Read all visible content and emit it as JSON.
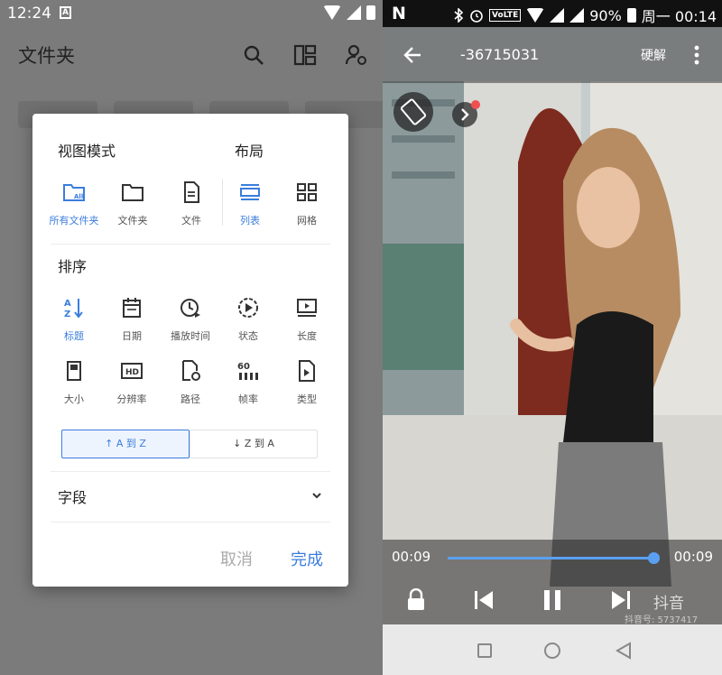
{
  "left": {
    "status": {
      "time": "12:24"
    },
    "appbar": {
      "title": "文件夹"
    },
    "dialog": {
      "view_mode_label": "视图模式",
      "layout_label": "布局",
      "view_modes": [
        {
          "label": "所有文件夹",
          "icon": "all-folders-icon",
          "active": true
        },
        {
          "label": "文件夹",
          "icon": "folder-icon",
          "active": false
        },
        {
          "label": "文件",
          "icon": "file-icon",
          "active": false
        }
      ],
      "layouts": [
        {
          "label": "列表",
          "icon": "list-icon",
          "active": true
        },
        {
          "label": "网格",
          "icon": "grid-icon",
          "active": false
        }
      ],
      "sort_label": "排序",
      "sort_row1": [
        {
          "label": "标题",
          "icon": "sort-az-icon",
          "active": true
        },
        {
          "label": "日期",
          "icon": "calendar-icon",
          "active": false
        },
        {
          "label": "播放时间",
          "icon": "clock-icon",
          "active": false
        },
        {
          "label": "状态",
          "icon": "play-status-icon",
          "active": false
        },
        {
          "label": "长度",
          "icon": "length-icon",
          "active": false
        }
      ],
      "sort_row2": [
        {
          "label": "大小",
          "icon": "sd-card-icon",
          "active": false
        },
        {
          "label": "分辨率",
          "icon": "hd-icon",
          "active": false
        },
        {
          "label": "路径",
          "icon": "path-icon",
          "active": false
        },
        {
          "label": "帧率",
          "icon": "framerate-icon",
          "active": false
        },
        {
          "label": "类型",
          "icon": "type-icon",
          "active": false
        }
      ],
      "order_asc": "↑ A 到 Z",
      "order_desc": "↓ Z 到 A",
      "fields_label": "字段",
      "cancel": "取消",
      "done": "完成"
    }
  },
  "right": {
    "status": {
      "net": "N",
      "volte": "VoLTE",
      "battery": "90%",
      "datetime": "周一 00:14"
    },
    "player": {
      "title": "-36715031",
      "decoder": "硬解",
      "current_time": "00:09",
      "total_time": "00:09",
      "progress": 1.0,
      "watermark": "抖音",
      "watermark_id": "抖音号: 5737417"
    }
  },
  "colors": {
    "accent": "#3b7ddd",
    "progress": "#5aa0f2"
  }
}
